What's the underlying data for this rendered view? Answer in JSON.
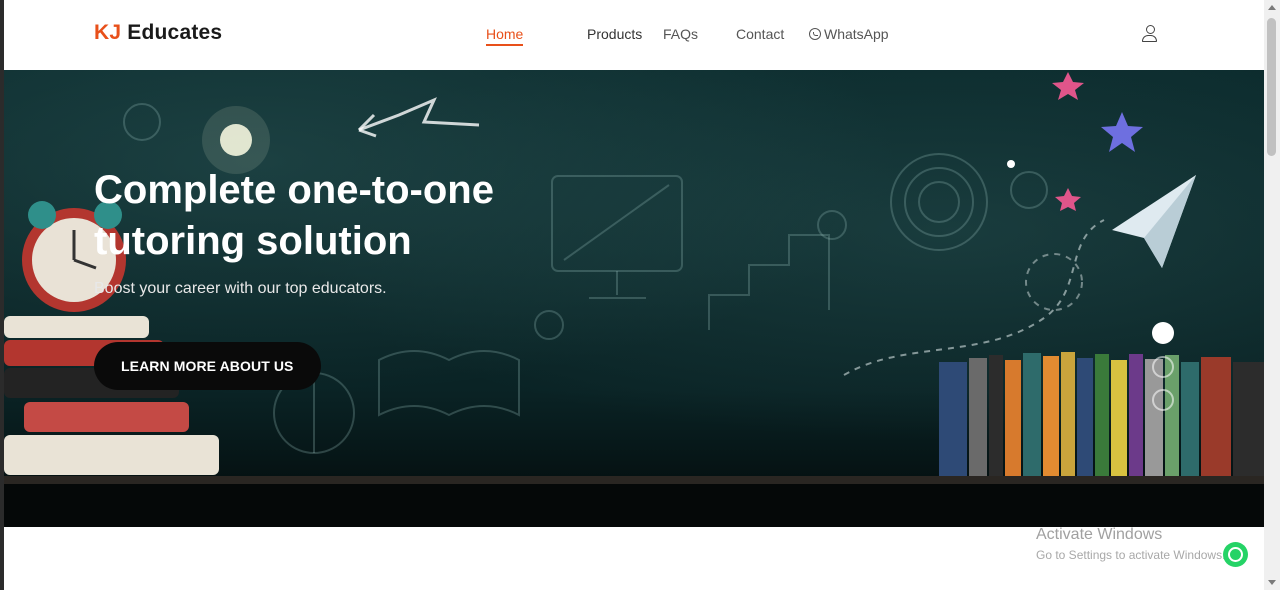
{
  "brand": {
    "accent": "KJ",
    "name": "Educates",
    "accent_color": "#e8501a"
  },
  "nav": {
    "items": [
      {
        "label": "Home",
        "active": true
      },
      {
        "label": "Products",
        "active": false
      },
      {
        "label": "FAQs",
        "active": false
      },
      {
        "label": "Contact",
        "active": false
      },
      {
        "label": "WhatsApp",
        "active": false
      }
    ],
    "account_icon": "user-icon"
  },
  "hero": {
    "title": "Complete one-to-one tutoring solution",
    "subtitle": "Boost your career with our top educators.",
    "cta_label": "LEARN MORE ABOUT US",
    "slides_total": 3,
    "active_slide": 1,
    "background_color": "#0b2a2c"
  },
  "watermark": {
    "title": "Activate Windows",
    "subtitle": "Go to Settings to activate Windows."
  },
  "floating_action": {
    "icon": "whatsapp-icon",
    "color": "#25d366"
  }
}
